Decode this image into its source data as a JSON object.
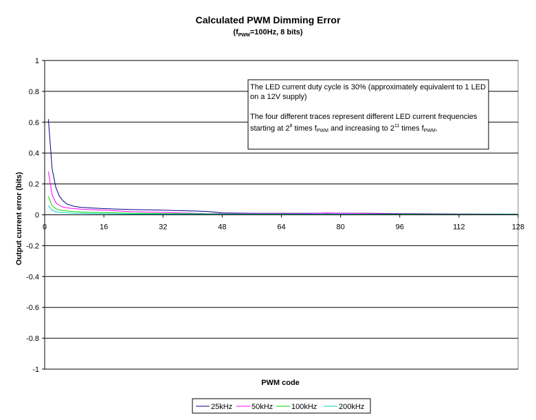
{
  "chart_data": {
    "type": "line",
    "title": "Calculated PWM Dimming Error",
    "subtitle": {
      "open": "(f",
      "sub": "PWM",
      "rest": "=100Hz, 8 bits)"
    },
    "xlabel": "PWM code",
    "ylabel": "Output current error (bits)",
    "xlim": [
      0,
      128
    ],
    "ylim": [
      -1,
      1
    ],
    "xticks": [
      "0",
      "16",
      "32",
      "48",
      "64",
      "80",
      "96",
      "112",
      "128"
    ],
    "yticks": [
      "1",
      "0.8",
      "0.6",
      "0.4",
      "0.2",
      "0",
      "-0.2",
      "-0.4",
      "-0.6",
      "-0.8",
      "-1"
    ],
    "grid": "horizontal",
    "legend_position": "bottom",
    "annotation": {
      "line1": "The LED current duty cycle is 30% (approximately equivalent to 1 LED",
      "line2": "on a 12V supply)",
      "line3": "The four different traces represent different LED current frequencies",
      "line4_a": "starting at 2",
      "line4_sup1": "8",
      "line4_b": " times f",
      "line4_sub1": "PWM",
      "line4_c": " and increasing to 2",
      "line4_sup2": "11",
      "line4_d": " times f",
      "line4_sub2": "PWM",
      "line4_e": "."
    },
    "series": [
      {
        "name": "25kHz",
        "color": "#000080",
        "x": [
          1,
          2,
          3,
          4,
          5,
          6,
          8,
          10,
          12,
          16,
          20,
          24,
          28,
          32,
          36,
          40,
          44,
          48,
          56,
          64,
          72,
          80,
          88,
          96,
          112,
          128
        ],
        "y": [
          0.62,
          0.3,
          0.18,
          0.12,
          0.09,
          0.07,
          0.055,
          0.048,
          0.045,
          0.04,
          0.037,
          0.034,
          0.032,
          0.03,
          0.027,
          0.025,
          0.022,
          0.012,
          0.01,
          0.01,
          0.01,
          0.01,
          0.01,
          0.008,
          0.006,
          0.005
        ]
      },
      {
        "name": "50kHz",
        "color": "#FF00FF",
        "x": [
          1,
          2,
          3,
          4,
          5,
          6,
          8,
          10,
          12,
          16,
          20,
          24,
          28,
          32,
          36,
          40,
          44,
          48,
          56,
          64,
          72,
          76,
          80,
          88,
          96,
          112,
          128
        ],
        "y": [
          0.28,
          0.13,
          0.08,
          0.06,
          0.05,
          0.045,
          0.04,
          0.036,
          0.034,
          0.03,
          0.025,
          0.02,
          0.018,
          0.015,
          0.013,
          0.01,
          0.008,
          0.008,
          0.008,
          0.008,
          0.008,
          0.012,
          0.01,
          0.008,
          0.006,
          0.005,
          0.004
        ]
      },
      {
        "name": "100kHz",
        "color": "#00CC00",
        "x": [
          1,
          2,
          3,
          4,
          6,
          8,
          10,
          12,
          16,
          20,
          24,
          32,
          40,
          48,
          56,
          64,
          80,
          96,
          112,
          128
        ],
        "y": [
          0.12,
          0.06,
          0.04,
          0.03,
          0.025,
          0.02,
          0.018,
          0.016,
          0.014,
          0.012,
          0.01,
          0.008,
          0.007,
          0.006,
          0.005,
          0.005,
          0.004,
          0.004,
          0.003,
          0.003
        ]
      },
      {
        "name": "200kHz",
        "color": "#00CCCC",
        "x": [
          1,
          2,
          3,
          4,
          6,
          8,
          10,
          12,
          16,
          20,
          24,
          32,
          40,
          48,
          56,
          64,
          80,
          96,
          112,
          128
        ],
        "y": [
          0.06,
          0.03,
          0.02,
          0.015,
          0.012,
          0.01,
          0.009,
          0.008,
          0.007,
          0.006,
          0.005,
          0.004,
          0.004,
          0.003,
          0.003,
          0.003,
          0.003,
          0.002,
          0.002,
          0.002
        ]
      }
    ]
  }
}
